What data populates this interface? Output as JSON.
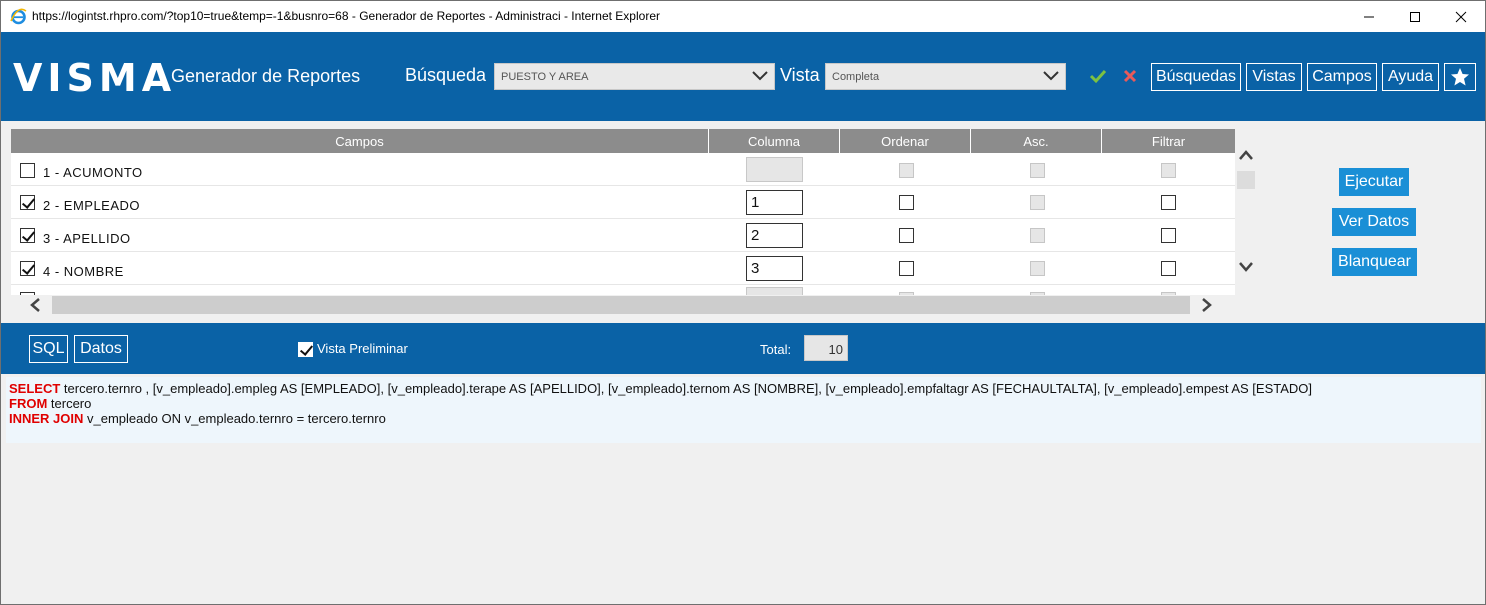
{
  "window": {
    "title": "https://logintst.rhpro.com/?top10=true&temp=-1&busnro=68 - Generador de Reportes - Administraci - Internet Explorer"
  },
  "header": {
    "logo": "VISMA",
    "app_title": "Generador de Reportes",
    "busqueda_label": "Búsqueda",
    "busqueda_value": "PUESTO Y AREA",
    "vista_label": "Vista",
    "vista_value": "Completa",
    "buttons": {
      "busquedas": "Búsquedas",
      "vistas": "Vistas",
      "campos": "Campos",
      "ayuda": "Ayuda"
    },
    "colors": {
      "accent": "#0a62a6",
      "check": "#7dc142",
      "cancel": "#e85a5a"
    }
  },
  "grid": {
    "headers": {
      "campos": "Campos",
      "columna": "Columna",
      "ordenar": "Ordenar",
      "asc": "Asc.",
      "filtrar": "Filtrar"
    },
    "rows": [
      {
        "label": "1 - ACUMONTO",
        "checked": false,
        "columna": ""
      },
      {
        "label": "2 - EMPLEADO",
        "checked": true,
        "columna": "1"
      },
      {
        "label": "3 - APELLIDO",
        "checked": true,
        "columna": "2"
      },
      {
        "label": "4 - NOMBRE",
        "checked": true,
        "columna": "3"
      }
    ]
  },
  "side_buttons": {
    "ejecutar": "Ejecutar",
    "ver_datos": "Ver Datos",
    "blanquear": "Blanquear"
  },
  "bottom": {
    "sql_button": "SQL",
    "datos_button": "Datos",
    "vista_preliminar": "Vista Preliminar",
    "total_label": "Total:",
    "total_value": "10"
  },
  "sql": {
    "select_kw": "SELECT",
    "select_text": " tercero.ternro , [v_empleado].empleg AS [EMPLEADO], [v_empleado].terape AS [APELLIDO], [v_empleado].ternom AS [NOMBRE], [v_empleado].empfaltagr AS [FECHAULTALTA], [v_empleado].empest AS [ESTADO]",
    "from_kw": "FROM",
    "from_text": " tercero",
    "join_kw": "INNER JOIN",
    "join_text": " v_empleado ON v_empleado.ternro = tercero.ternro"
  }
}
